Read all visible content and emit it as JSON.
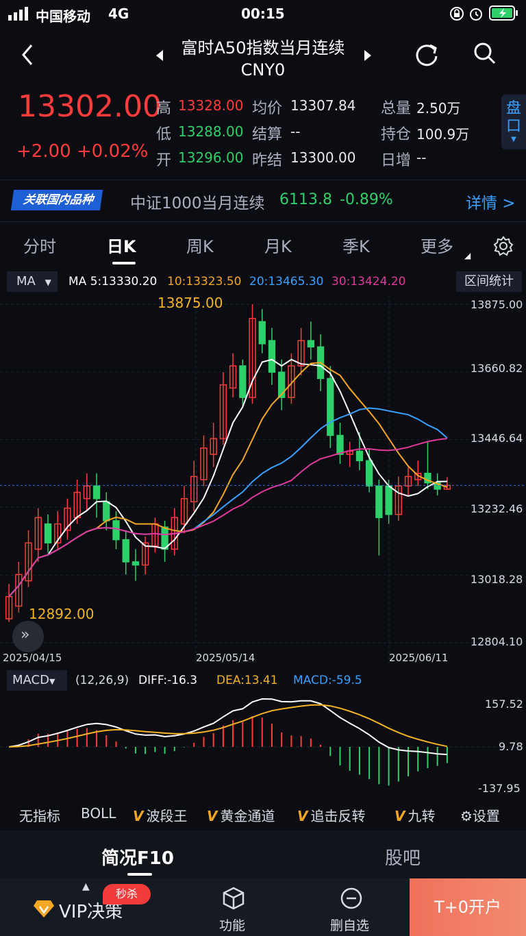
{
  "status_bar": {
    "carrier": "中国移动",
    "network": "4G",
    "time": "00:15"
  },
  "header": {
    "title": "富时A50指数当月连续",
    "code": "CNY0"
  },
  "quote": {
    "price": "13302.00",
    "change": "+2.00",
    "change_pct": "+0.02%",
    "high_label": "高",
    "high": "13328.00",
    "low_label": "低",
    "low": "13288.00",
    "open_label": "开",
    "open": "13296.00",
    "avg_label": "均价",
    "avg": "13307.84",
    "settle_label": "结算",
    "settle": "--",
    "prev_settle_label": "昨结",
    "prev_settle": "13300.00",
    "volume_label": "总量",
    "volume": "2.50万",
    "oi_label": "持仓",
    "oi": "100.9万",
    "daily_inc_label": "日增",
    "daily_inc": "--",
    "pankou": "盘口"
  },
  "related": {
    "badge": "关联国内品种",
    "name": "中证1000当月连续",
    "price": "6113.8",
    "change_pct": "-0.89%",
    "detail": "详情 >"
  },
  "tabs": [
    "分时",
    "日K",
    "周K",
    "月K",
    "季K",
    "更多"
  ],
  "ma": {
    "selector": "MA",
    "ma5": "MA 5:13330.20",
    "ma10": "10:13323.50",
    "ma20": "20:13465.30",
    "ma30": "30:13424.20",
    "range_stats": "区间统计"
  },
  "price_axis": [
    "13875.00",
    "13660.82",
    "13446.64",
    "13232.46",
    "13018.28",
    "12804.10"
  ],
  "date_axis": [
    "2025/04/15",
    "2025/05/14",
    "2025/06/11"
  ],
  "extremes": {
    "high": "13875.00",
    "low": "12892.00"
  },
  "macd": {
    "selector": "MACD",
    "params": "(12,26,9)",
    "diff": "DIFF:-16.3",
    "dea": "DEA:13.41",
    "macd": "MACD:-59.5",
    "axis": [
      "157.52",
      "9.78",
      "-137.95"
    ]
  },
  "indicators": [
    "无指标",
    "BOLL",
    "波段王",
    "黄金通道",
    "追击反转",
    "九转",
    "设置"
  ],
  "subtabs": [
    "简况F10",
    "股吧"
  ],
  "bottom": {
    "vip": "VIP决策",
    "seckill": "秒杀",
    "func": "功能",
    "remove": "删自选",
    "open": "T+0开户"
  },
  "colors": {
    "up": "#ff3b3b",
    "down": "#2fd06a",
    "ma5": "#ffffff",
    "ma10": "#f5a623",
    "ma20": "#3aa0ff",
    "ma30": "#e0399a",
    "accent": "#1f5fd6"
  },
  "chart_data": {
    "type": "candlestick",
    "ylim": [
      12804.1,
      13875.0
    ],
    "candles": [
      {
        "o": 12880,
        "c": 12950,
        "h": 12990,
        "l": 12870
      },
      {
        "o": 12920,
        "c": 13020,
        "h": 13060,
        "l": 12900
      },
      {
        "o": 13000,
        "c": 13120,
        "h": 13160,
        "l": 12980
      },
      {
        "o": 13100,
        "c": 13200,
        "h": 13230,
        "l": 13060
      },
      {
        "o": 13180,
        "c": 13120,
        "h": 13210,
        "l": 13090
      },
      {
        "o": 13120,
        "c": 13180,
        "h": 13220,
        "l": 13100
      },
      {
        "o": 13160,
        "c": 13230,
        "h": 13260,
        "l": 13130
      },
      {
        "o": 13200,
        "c": 13280,
        "h": 13320,
        "l": 13180
      },
      {
        "o": 13260,
        "c": 13300,
        "h": 13340,
        "l": 13220
      },
      {
        "o": 13300,
        "c": 13260,
        "h": 13340,
        "l": 13200
      },
      {
        "o": 13250,
        "c": 13190,
        "h": 13280,
        "l": 13160
      },
      {
        "o": 13190,
        "c": 13130,
        "h": 13220,
        "l": 13100
      },
      {
        "o": 13130,
        "c": 13060,
        "h": 13160,
        "l": 13020
      },
      {
        "o": 13060,
        "c": 13050,
        "h": 13100,
        "l": 13000
      },
      {
        "o": 13050,
        "c": 13120,
        "h": 13140,
        "l": 13020
      },
      {
        "o": 13110,
        "c": 13180,
        "h": 13200,
        "l": 13090
      },
      {
        "o": 13170,
        "c": 13100,
        "h": 13190,
        "l": 13060
      },
      {
        "o": 13100,
        "c": 13200,
        "h": 13230,
        "l": 13080
      },
      {
        "o": 13180,
        "c": 13260,
        "h": 13300,
        "l": 13150
      },
      {
        "o": 13250,
        "c": 13330,
        "h": 13380,
        "l": 13220
      },
      {
        "o": 13320,
        "c": 13420,
        "h": 13460,
        "l": 13300
      },
      {
        "o": 13400,
        "c": 13450,
        "h": 13500,
        "l": 13360
      },
      {
        "o": 13450,
        "c": 13620,
        "h": 13660,
        "l": 13430
      },
      {
        "o": 13610,
        "c": 13680,
        "h": 13720,
        "l": 13580
      },
      {
        "o": 13680,
        "c": 13580,
        "h": 13700,
        "l": 13550
      },
      {
        "o": 13580,
        "c": 13830,
        "h": 13875,
        "l": 13560
      },
      {
        "o": 13820,
        "c": 13750,
        "h": 13860,
        "l": 13720
      },
      {
        "o": 13760,
        "c": 13660,
        "h": 13800,
        "l": 13620
      },
      {
        "o": 13660,
        "c": 13580,
        "h": 13700,
        "l": 13540
      },
      {
        "o": 13580,
        "c": 13680,
        "h": 13720,
        "l": 13560
      },
      {
        "o": 13680,
        "c": 13760,
        "h": 13800,
        "l": 13650
      },
      {
        "o": 13760,
        "c": 13740,
        "h": 13820,
        "l": 13700
      },
      {
        "o": 13740,
        "c": 13640,
        "h": 13780,
        "l": 13600
      },
      {
        "o": 13640,
        "c": 13460,
        "h": 13680,
        "l": 13420
      },
      {
        "o": 13460,
        "c": 13400,
        "h": 13500,
        "l": 13370
      },
      {
        "o": 13400,
        "c": 13410,
        "h": 13440,
        "l": 13360
      },
      {
        "o": 13410,
        "c": 13380,
        "h": 13470,
        "l": 13350
      },
      {
        "o": 13380,
        "c": 13300,
        "h": 13420,
        "l": 13280
      },
      {
        "o": 13300,
        "c": 13200,
        "h": 13320,
        "l": 13080
      },
      {
        "o": 13300,
        "c": 13210,
        "h": 13320,
        "l": 13180
      },
      {
        "o": 13210,
        "c": 13300,
        "h": 13330,
        "l": 13190
      },
      {
        "o": 13300,
        "c": 13330,
        "h": 13360,
        "l": 13270
      },
      {
        "o": 13320,
        "c": 13340,
        "h": 13380,
        "l": 13300
      },
      {
        "o": 13340,
        "c": 13310,
        "h": 13440,
        "l": 13290
      },
      {
        "o": 13310,
        "c": 13290,
        "h": 13340,
        "l": 13270
      },
      {
        "o": 13290,
        "c": 13302,
        "h": 13328,
        "l": 13288
      }
    ]
  }
}
